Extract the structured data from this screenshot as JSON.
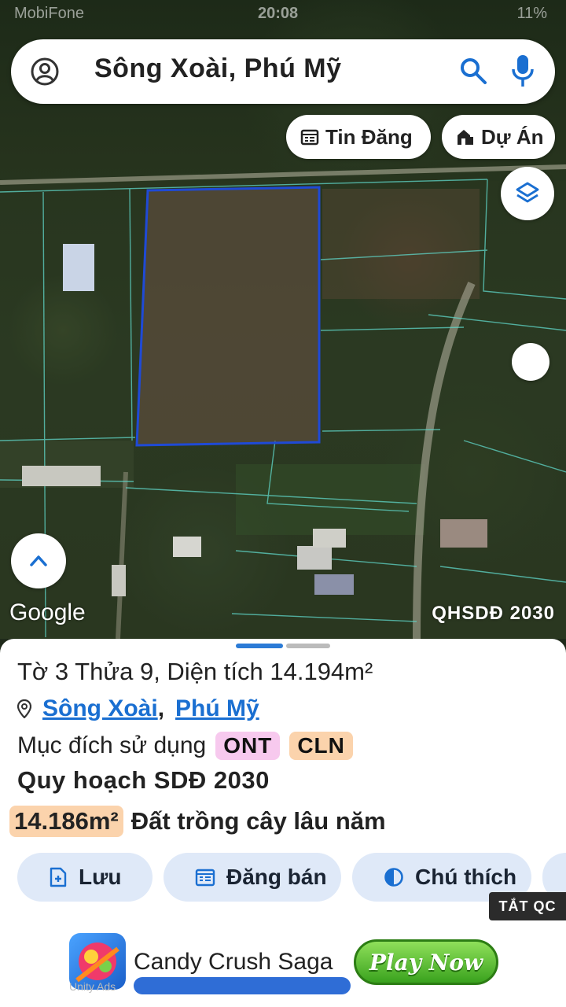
{
  "status_bar": {
    "carrier": "MobiFone",
    "time": "20:08",
    "battery": "11%"
  },
  "search": {
    "query": "Sông Xoài, Phú Mỹ"
  },
  "chips": {
    "listings": "Tin Đăng",
    "projects": "Dự Án"
  },
  "map": {
    "attribution": "Google",
    "plan_layer": "QHSDĐ 2030"
  },
  "parcel": {
    "title": "Tờ 3 Thửa 9, Diện tích 14.194m²",
    "commune": "Sông Xoài",
    "comma": ",",
    "district": "Phú Mỹ",
    "usage_label": "Mục đích sử dụng",
    "usage_codes": [
      "ONT",
      "CLN"
    ],
    "plan_title": "Quy hoạch SDĐ 2030",
    "plan_area": "14.186m²",
    "plan_use": "Đất trồng cây lâu năm"
  },
  "actions": {
    "save": "Lưu",
    "sell": "Đăng bán",
    "legend": "Chú thích"
  },
  "ad": {
    "hide_label": "TẮT QC",
    "app_name": "Candy Crush Saga",
    "cta": "Play Now",
    "network": "Unity Ads"
  },
  "colors": {
    "accent": "#1a6fd1",
    "tag_ont": "#f7c9ee",
    "tag_cln": "#fbd3ac",
    "parcel_outline": "#1f4ad6"
  }
}
